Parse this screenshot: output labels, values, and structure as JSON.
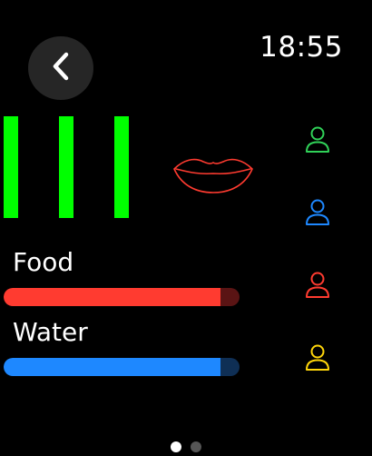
{
  "status_bar": {
    "time": "18:55"
  },
  "nav": {
    "back_icon": "chevron-left-icon"
  },
  "indicators": {
    "bar_color": "#00ff00",
    "bar_count": 3,
    "mouth_icon": "lips-icon",
    "mouth_color": "#ff3b30"
  },
  "meters": [
    {
      "label": "Food",
      "progress": 0.92,
      "fill_color": "#ff3b30",
      "track_color": "#5a1414"
    },
    {
      "label": "Water",
      "progress": 0.92,
      "fill_color": "#1e88ff",
      "track_color": "#0f2f55"
    }
  ],
  "people": [
    {
      "icon": "person-icon",
      "color": "#30d158",
      "selected": true
    },
    {
      "icon": "person-icon",
      "color": "#1e88ff",
      "selected": false
    },
    {
      "icon": "person-icon",
      "color": "#ff3b30",
      "selected": false
    },
    {
      "icon": "person-icon",
      "color": "#ffd60a",
      "selected": false
    }
  ],
  "pagination": {
    "page_count": 2,
    "current_page": 1
  }
}
